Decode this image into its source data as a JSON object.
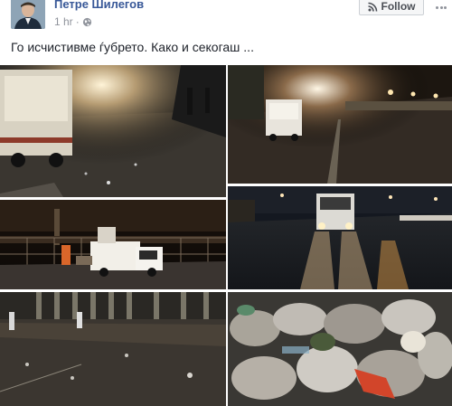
{
  "post": {
    "author": "Петре Шилегов",
    "time": "1 hr",
    "text": "Го исчистивме ѓубрето. Како и секогаш ...",
    "follow_label": "Follow"
  },
  "icons": {
    "privacy": "globe-icon",
    "follow": "rss-icon",
    "menu": "more-dots-icon"
  },
  "colors": {
    "author_link": "#385898",
    "meta_text": "#90949c",
    "body_text": "#1d2129"
  }
}
